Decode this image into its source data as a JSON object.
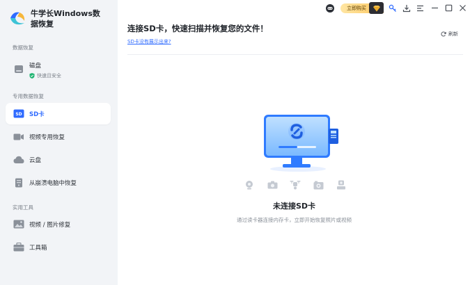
{
  "app": {
    "title": "牛学长Windows数据恢复"
  },
  "titlebar": {
    "buy_label": "立即购买",
    "icons": [
      "robot-icon",
      "key-icon",
      "download-icon",
      "menu-icon",
      "minimize-icon",
      "maximize-icon",
      "close-icon"
    ]
  },
  "sidebar": {
    "sections": [
      {
        "label": "数据恢复"
      },
      {
        "label": "专用数据恢复"
      },
      {
        "label": "实用工具"
      }
    ],
    "items": [
      {
        "label": "磁盘",
        "sub": "快速且安全",
        "icon": "disk-icon"
      },
      {
        "label": "SD卡",
        "icon": "sd-card-icon",
        "active": true
      },
      {
        "label": "视频专用恢复",
        "icon": "video-camera-icon"
      },
      {
        "label": "云盘",
        "icon": "cloud-icon"
      },
      {
        "label": "从崩溃电脑中恢复",
        "icon": "crashed-pc-icon"
      },
      {
        "label": "视频 / 图片修复",
        "icon": "photo-repair-icon"
      },
      {
        "label": "工具箱",
        "icon": "toolbox-icon"
      }
    ]
  },
  "main": {
    "title": "连接SD卡，快速扫描并恢复您的文件！",
    "help_link": "SD卡没有展示出来?",
    "refresh_label": "刷新",
    "empty_title": "未连接SD卡",
    "empty_desc": "通过读卡器连接内存卡，立即开始恢复照片或视频",
    "device_icons": [
      "webcam-icon",
      "camera-icon",
      "drone-icon",
      "action-camera-icon",
      "dashcam-icon"
    ]
  },
  "colors": {
    "accent": "#2f6bff",
    "sidebar_bg": "#f2f4f7",
    "buy_gold": "#fcc65f"
  }
}
